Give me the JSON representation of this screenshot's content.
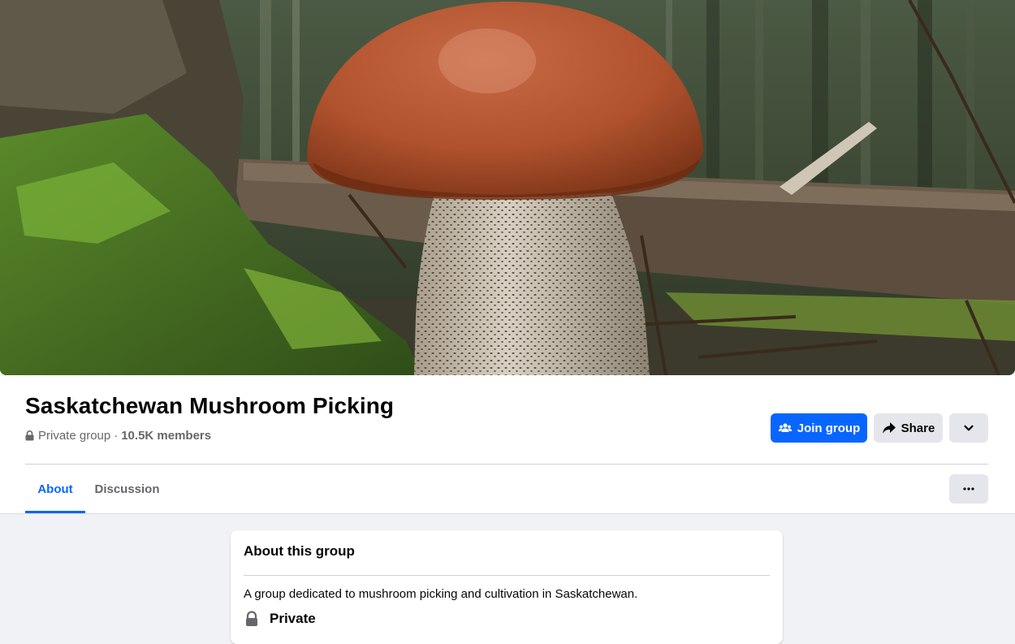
{
  "group": {
    "name": "Saskatchewan Mushroom Picking",
    "privacy": "Private group",
    "separator": "·",
    "members": "10.5K members"
  },
  "actions": {
    "join_label": "Join group",
    "share_label": "Share"
  },
  "tabs": [
    {
      "label": "About",
      "active": true
    },
    {
      "label": "Discussion",
      "active": false
    }
  ],
  "about": {
    "title": "About this group",
    "description": "A group dedicated to mushroom picking and cultivation in Saskatchewan.",
    "privacy_label": "Private"
  },
  "icons": {
    "lock": "lock-icon",
    "join": "people-icon",
    "share": "share-arrow-icon",
    "more": "chevron-down-icon",
    "tab_more": "ellipsis-icon"
  },
  "colors": {
    "accent": "#0866ff",
    "secondary_button": "#e4e6eb",
    "muted_text": "#65676b",
    "page_background": "#f0f2f5"
  }
}
